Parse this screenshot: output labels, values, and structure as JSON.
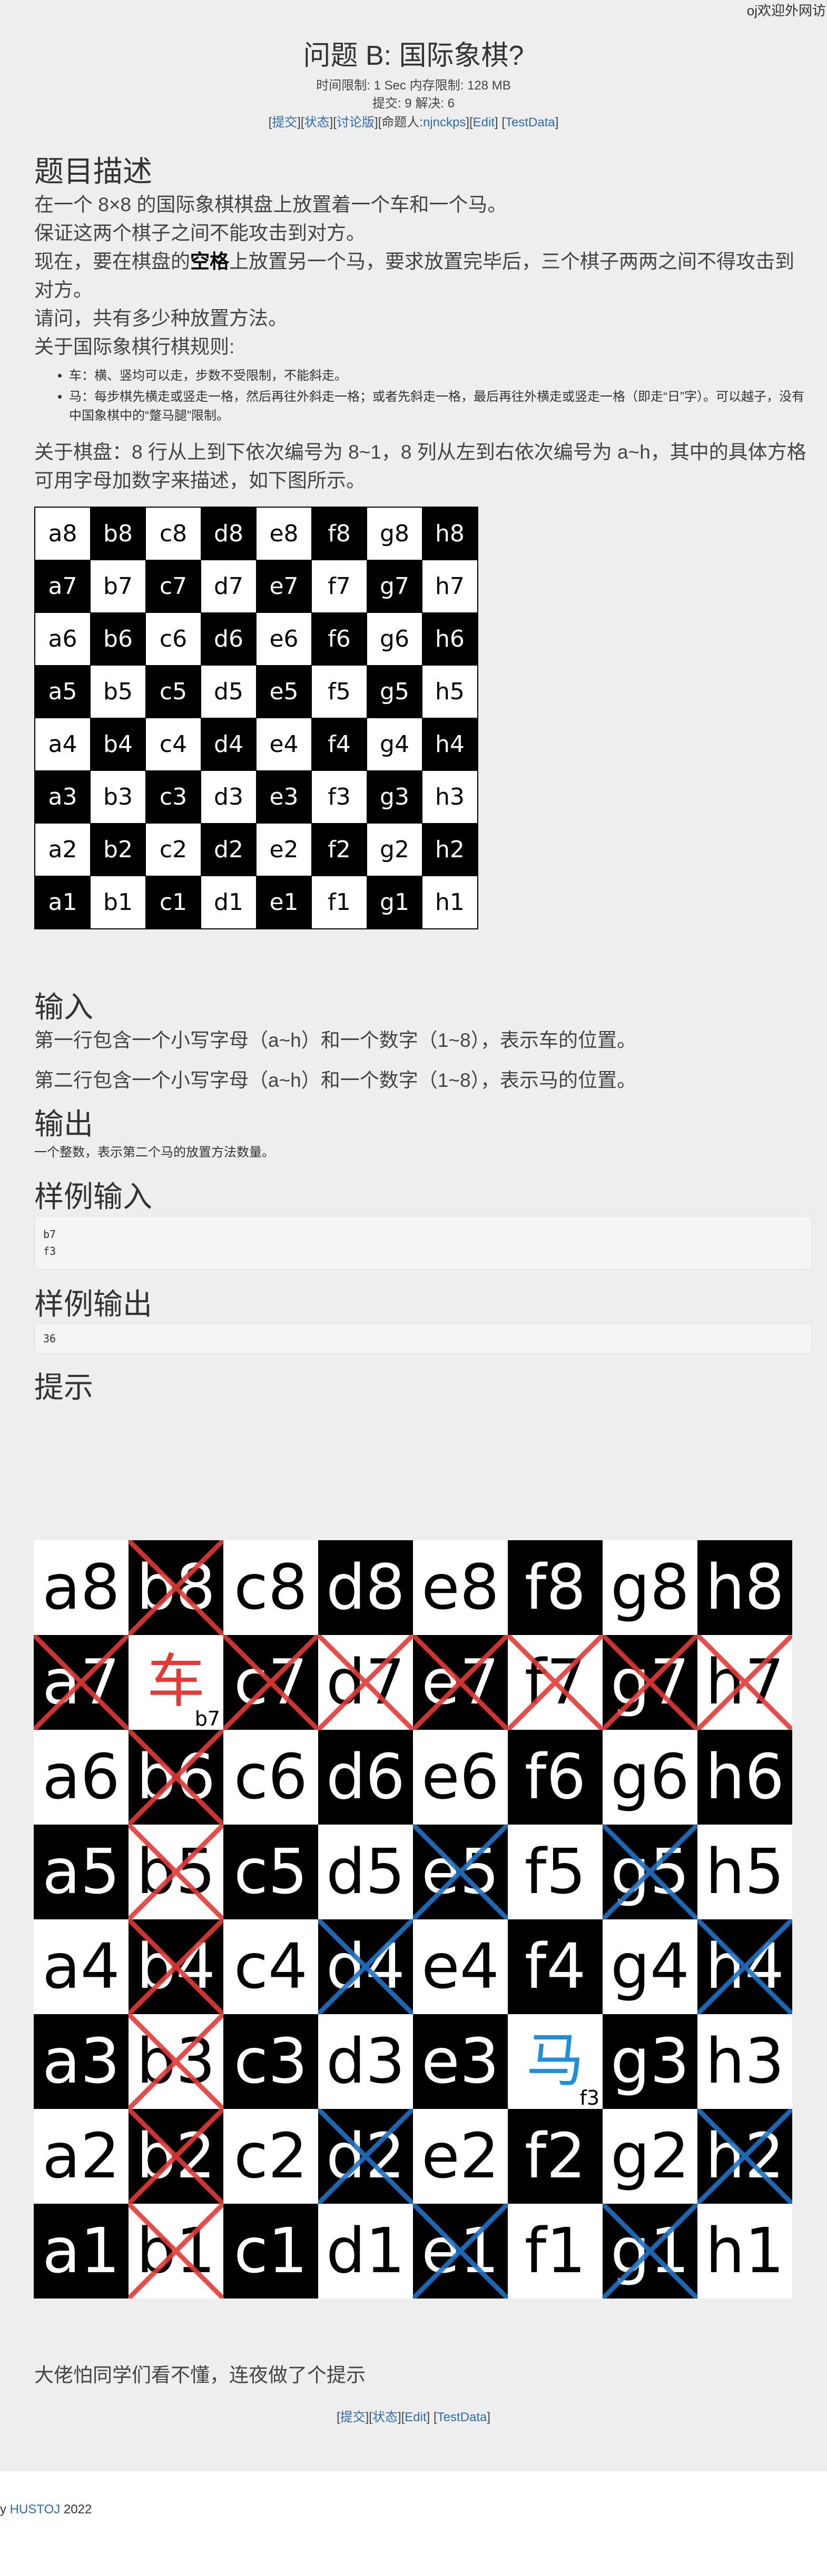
{
  "top_right": "oj欢迎外网访",
  "problem": {
    "title": "问题 B: 国际象棋?",
    "limits": "时间限制: 1 Sec  内存限制: 128 MB",
    "stats": "提交: 9  解决: 6",
    "links": {
      "submit": "提交",
      "status": "状态",
      "discuss": "讨论版",
      "author_label": "命题人:",
      "author": "njnckps",
      "edit": "Edit",
      "testdata": "TestData"
    }
  },
  "sections": {
    "description_title": "题目描述",
    "desc_p1": "在一个 8×8 的国际象棋棋盘上放置着一个车和一个马。",
    "desc_p2": "保证这两个棋子之间不能攻击到对方。",
    "desc_p3_a": "现在，要在棋盘的",
    "desc_p3_bold": "空格",
    "desc_p3_b": "上放置另一个马，要求放置完毕后，三个棋子两两之间不得攻击到对方。",
    "desc_p4": "请问，共有多少种放置方法。",
    "desc_p5": "关于国际象棋行棋规则:",
    "rule1": "车：横、竖均可以走，步数不受限制，不能斜走。",
    "rule2": "马：每步棋先横走或竖走一格，然后再往外斜走一格；或者先斜走一格，最后再往外横走或竖走一格（即走“日”字）。可以越子，没有中国象棋中的“蹩马腿”限制。",
    "desc_p6": "关于棋盘：8 行从上到下依次编号为 8~1，8 列从左到右依次编号为 a~h，其中的具体方格可用字母加数字来描述，如下图所示。",
    "input_title": "输入",
    "input_p1": "第一行包含一个小写字母（a~h）和一个数字（1~8），表示车的位置。",
    "input_p2": "第二行包含一个小写字母（a~h）和一个数字（1~8），表示马的位置。",
    "output_title": "输出",
    "output_p1": "一个整数，表示第二个马的放置方法数量。",
    "sample_in_title": "样例输入",
    "sample_in_line1": "b7",
    "sample_in_line2": "f3",
    "sample_out_title": "样例输出",
    "sample_out": "36",
    "hint_title": "提示",
    "hint_text": "大佬怕同学们看不懂，连夜做了个提示"
  },
  "board": {
    "ranks": [
      "8",
      "7",
      "6",
      "5",
      "4",
      "3",
      "2",
      "1"
    ],
    "files": [
      "a",
      "b",
      "c",
      "d",
      "e",
      "f",
      "g",
      "h"
    ]
  },
  "hint": {
    "rook_symbol": "车",
    "rook_pos": "b7",
    "knight_symbol": "马",
    "knight_pos": "f3",
    "red_crosses": [
      "b8",
      "a7",
      "c7",
      "d7",
      "e7",
      "f7",
      "g7",
      "h7",
      "b6",
      "b5",
      "b4",
      "b3",
      "b2",
      "b1"
    ],
    "blue_crosses": [
      "e5",
      "g5",
      "d4",
      "h4",
      "d2",
      "h2",
      "e1",
      "g1"
    ],
    "colors": {
      "red": "#e53935",
      "blue": "#1e73c8",
      "rook": "#e53935",
      "knight": "#1e8ee0"
    }
  },
  "footer": {
    "submit": "提交",
    "status": "状态",
    "edit": "Edit",
    "testdata": "TestData",
    "copyright_prefix": "y ",
    "copyright_brand": "HUSTOJ",
    "copyright_year": " 2022"
  }
}
